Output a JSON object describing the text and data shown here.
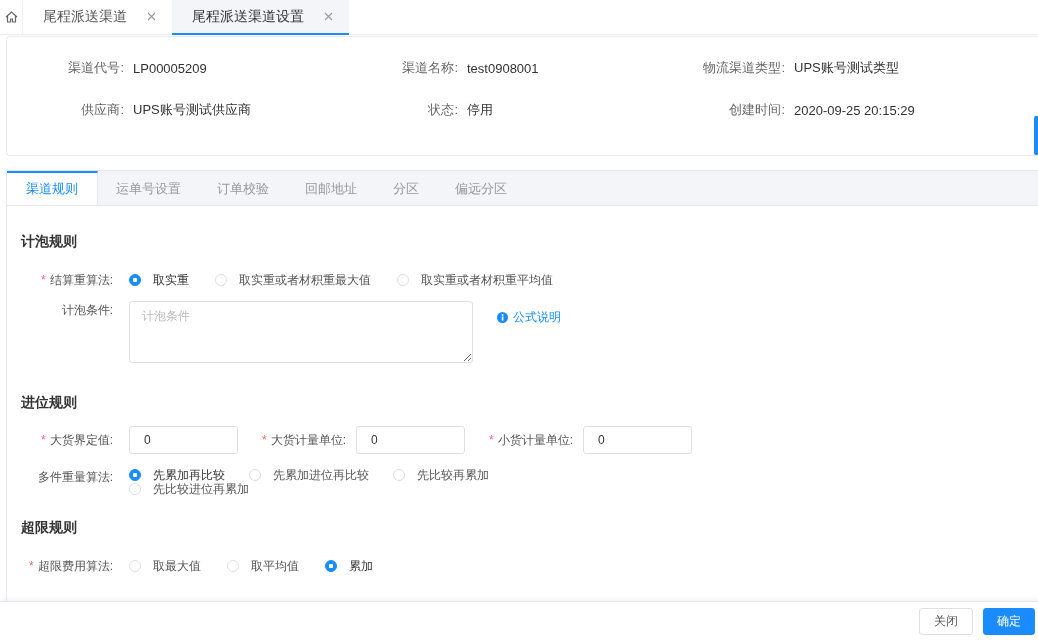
{
  "page_tabs": [
    {
      "label": "尾程派送渠道",
      "selected": false
    },
    {
      "label": "尾程派送渠道设置",
      "selected": true
    }
  ],
  "info": [
    {
      "label": "渠道代号:",
      "value": "LP00005209"
    },
    {
      "label": "渠道名称:",
      "value": "test0908001"
    },
    {
      "label": "物流渠道类型:",
      "value": "UPS账号测试类型"
    },
    {
      "label": "供应商:",
      "value": "UPS账号测试供应商"
    },
    {
      "label": "状态:",
      "value": "停用"
    },
    {
      "label": "创建时间:",
      "value": "2020-09-25 20:15:29"
    }
  ],
  "section_tabs": [
    {
      "label": "渠道规则",
      "selected": true
    },
    {
      "label": "运单号设置",
      "selected": false
    },
    {
      "label": "订单校验",
      "selected": false
    },
    {
      "label": "回邮地址",
      "selected": false
    },
    {
      "label": "分区",
      "selected": false
    },
    {
      "label": "偏远分区",
      "selected": false
    }
  ],
  "sections": [
    {
      "title": "计泡规则",
      "fields": [
        {
          "kind": "radio",
          "label": "结算重算法:",
          "marker": "*",
          "options": [
            {
              "label": "取实重",
              "selected": true
            },
            {
              "label": "取实重或者材积重最大值",
              "selected": false
            },
            {
              "label": "取实重或者材积重平均值",
              "selected": false
            }
          ]
        },
        {
          "kind": "textarea",
          "label": "计泡条件:",
          "placeholder": "计泡条件",
          "link": "公式说明"
        }
      ]
    },
    {
      "title": "进位规则",
      "fields": [
        {
          "kind": "inputs",
          "items": [
            {
              "label": "大货界定值:",
              "marker": "*",
              "value": "0"
            },
            {
              "label": "大货计量单位:",
              "marker": "*",
              "value": "0"
            },
            {
              "label": "小货计量单位:",
              "marker": "*",
              "value": "0"
            }
          ]
        },
        {
          "kind": "wrapradio",
          "label": "多件重量算法:",
          "options": [
            {
              "label": "先累加再比较",
              "selected": true
            },
            {
              "label": "先累加进位再比较",
              "selected": false
            },
            {
              "label": "先比较再累加",
              "selected": false
            },
            {
              "label": "先比较进位再累加",
              "selected": false
            }
          ]
        }
      ]
    },
    {
      "title": "超限规则",
      "fields": [
        {
          "kind": "radio",
          "label": "超限费用算法:",
          "marker": "*",
          "options": [
            {
              "label": "取最大值",
              "selected": false
            },
            {
              "label": "取平均值",
              "selected": false
            },
            {
              "label": "累加",
              "selected": true
            }
          ]
        }
      ]
    }
  ],
  "buttons": [
    {
      "label": "关闭",
      "kind": "default"
    },
    {
      "label": "确定",
      "kind": "primary"
    }
  ]
}
